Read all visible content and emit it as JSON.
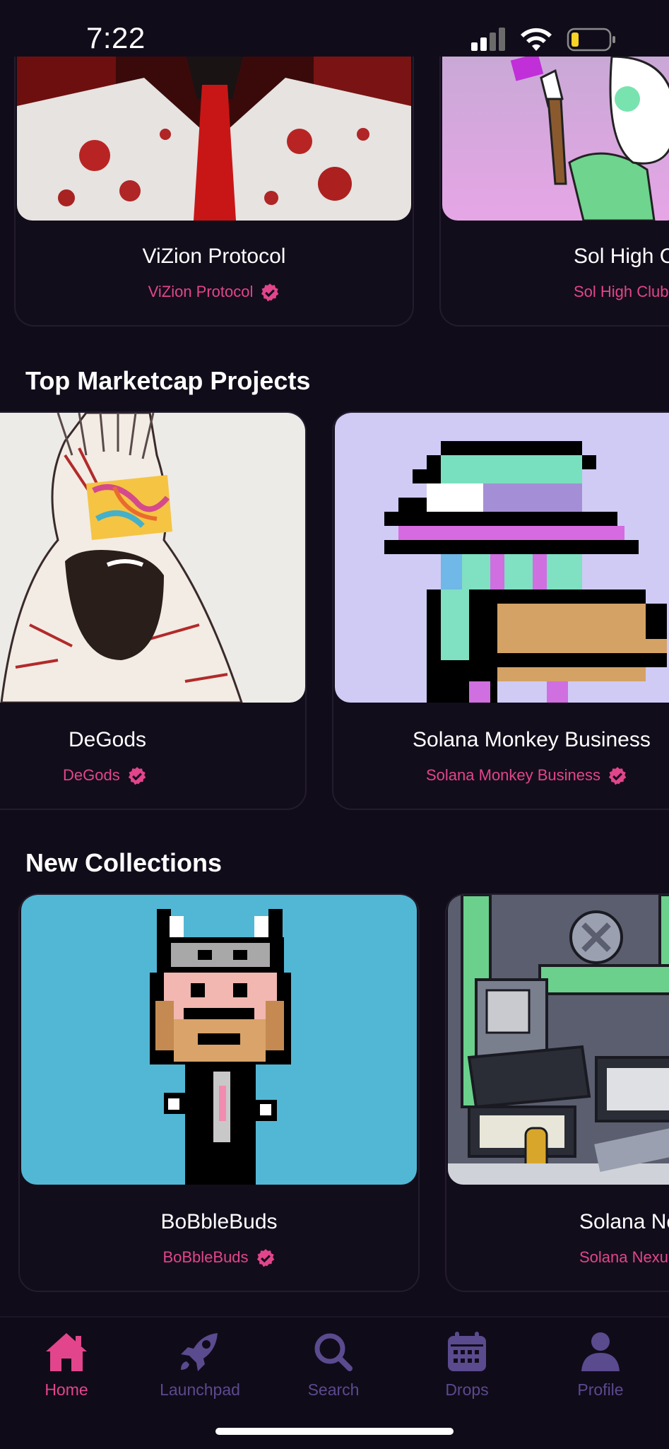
{
  "status_bar": {
    "time": "7:22"
  },
  "carousel_top": {
    "cards": [
      {
        "title": "ViZion Protocol",
        "subtitle": "ViZion Protocol"
      },
      {
        "title": "Sol High C",
        "subtitle": "Sol High Club"
      }
    ]
  },
  "sections": {
    "top_marketcap": {
      "title": "Top Marketcap Projects",
      "cards": [
        {
          "title": "DeGods",
          "subtitle": "DeGods"
        },
        {
          "title": "Solana Monkey Business",
          "subtitle": "Solana Monkey Business"
        }
      ]
    },
    "new_collections": {
      "title": "New Collections",
      "cards": [
        {
          "title": "BoBbleBuds",
          "subtitle": "BoBbleBuds"
        },
        {
          "title": "Solana Ne",
          "subtitle": "Solana Nexu"
        }
      ]
    }
  },
  "tab_bar": {
    "items": [
      {
        "label": "Home",
        "icon": "home-icon",
        "active": true
      },
      {
        "label": "Launchpad",
        "icon": "rocket-icon",
        "active": false
      },
      {
        "label": "Search",
        "icon": "search-icon",
        "active": false
      },
      {
        "label": "Drops",
        "icon": "calendar-icon",
        "active": false
      },
      {
        "label": "Profile",
        "icon": "profile-icon",
        "active": false
      }
    ]
  },
  "colors": {
    "background": "#110c1a",
    "accent": "#e2458c",
    "inactive": "#5a4a8e"
  }
}
